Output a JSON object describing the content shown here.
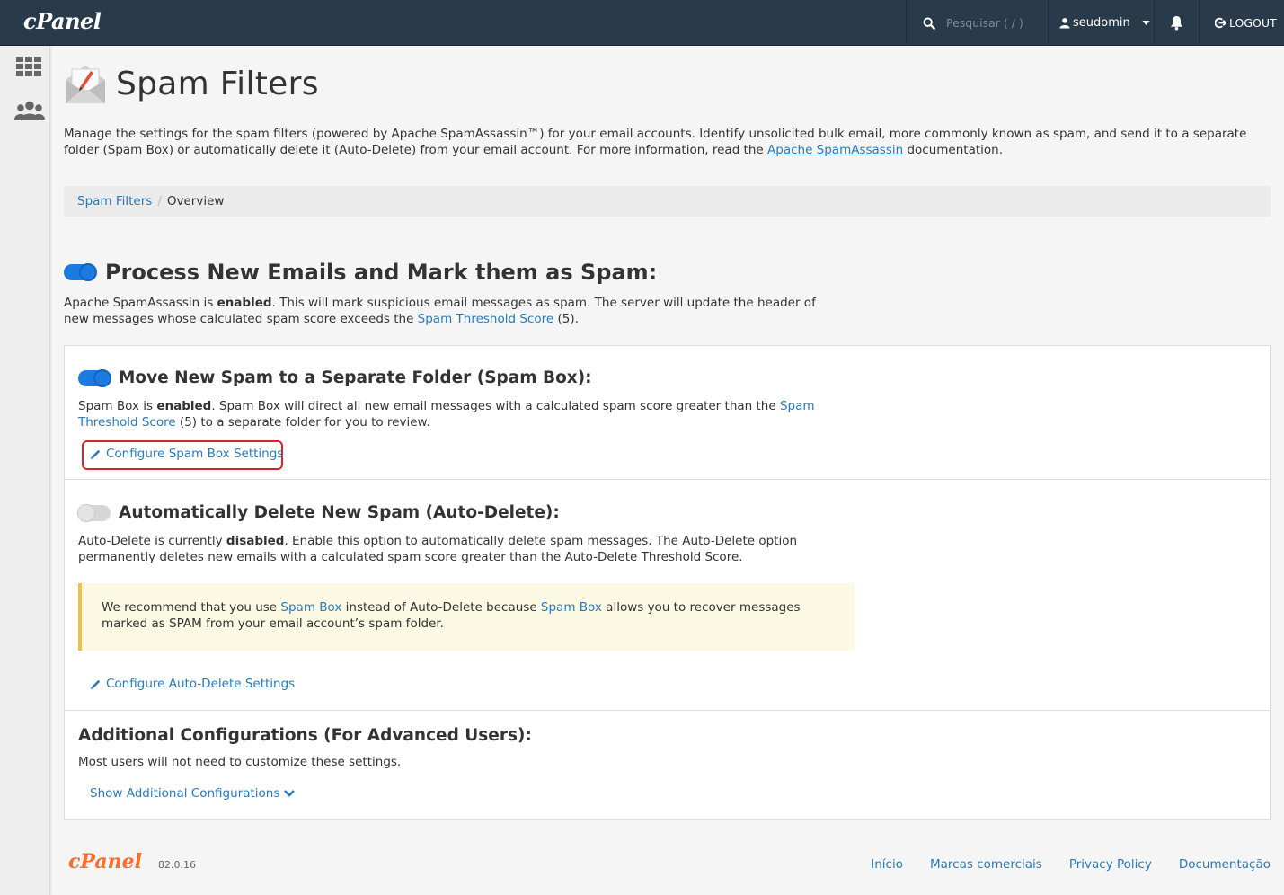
{
  "topbar": {
    "logo": "cPanel",
    "search_placeholder": "Pesquisar ( / )",
    "username": "seudomin",
    "logout": "LOGOUT"
  },
  "sidebar": {
    "icons": [
      "grid-icon",
      "users-icon"
    ]
  },
  "page": {
    "title": "Spam Filters",
    "intro_part1": "Manage the settings for the spam filters (powered by Apache SpamAssassin™) for your email accounts. Identify unsolicited bulk email, more commonly known as spam, and send it to a separate folder (Spam Box) or automatically delete it (Auto-Delete) from your email account. For more information, read the ",
    "intro_link": "Apache SpamAssassin",
    "intro_part2": " documentation."
  },
  "breadcrumb": {
    "root": "Spam Filters",
    "current": "Overview"
  },
  "process_section": {
    "title": "Process New Emails and Mark them as Spam:",
    "enabled": true,
    "desc_part1": "Apache SpamAssassin is ",
    "desc_bold": "enabled",
    "desc_part2": ". This will mark suspicious email messages as spam. The server will update the header of new messages whose calculated spam score exceeds the ",
    "desc_link": "Spam Threshold Score",
    "desc_part3": " (5)."
  },
  "spam_box": {
    "title": "Move New Spam to a Separate Folder (Spam Box):",
    "enabled": true,
    "desc_part1": "Spam Box is ",
    "desc_bold": "enabled",
    "desc_part2": ". Spam Box will direct all new email messages with a calculated spam score greater than the ",
    "desc_link": "Spam Threshold Score",
    "desc_part3": " (5) to a separate folder for you to review.",
    "configure_label": "Configure Spam Box Settings"
  },
  "auto_delete": {
    "title": "Automatically Delete New Spam (Auto-Delete):",
    "enabled": false,
    "desc_part1": "Auto-Delete is currently ",
    "desc_bold": "disabled",
    "desc_part2": ". Enable this option to automatically delete spam messages. The Auto-Delete option permanently deletes new emails with a calculated spam score greater than the Auto-Delete Threshold Score.",
    "warn_part1": "We recommend that you use ",
    "warn_link1": "Spam Box",
    "warn_part2": " instead of Auto-Delete because ",
    "warn_link2": "Spam Box",
    "warn_part3": " allows you to recover messages marked as SPAM from your email account’s spam folder.",
    "configure_label": "Configure Auto-Delete Settings"
  },
  "advanced": {
    "title": "Additional Configurations (For Advanced Users):",
    "desc": "Most users will not need to customize these settings.",
    "show_label": "Show Additional Configurations"
  },
  "footer": {
    "logo": "cPanel",
    "version": "82.0.16",
    "links": [
      "Início",
      "Marcas comerciais",
      "Privacy Policy",
      "Documentação"
    ]
  },
  "colors": {
    "topbar": "#293a4a",
    "link": "#2a7ab8",
    "toggle_on": "#1c7ae0",
    "highlight": "#d8232a",
    "warning_bg": "#fbf8e3",
    "footer_logo": "#ff6c2c"
  }
}
